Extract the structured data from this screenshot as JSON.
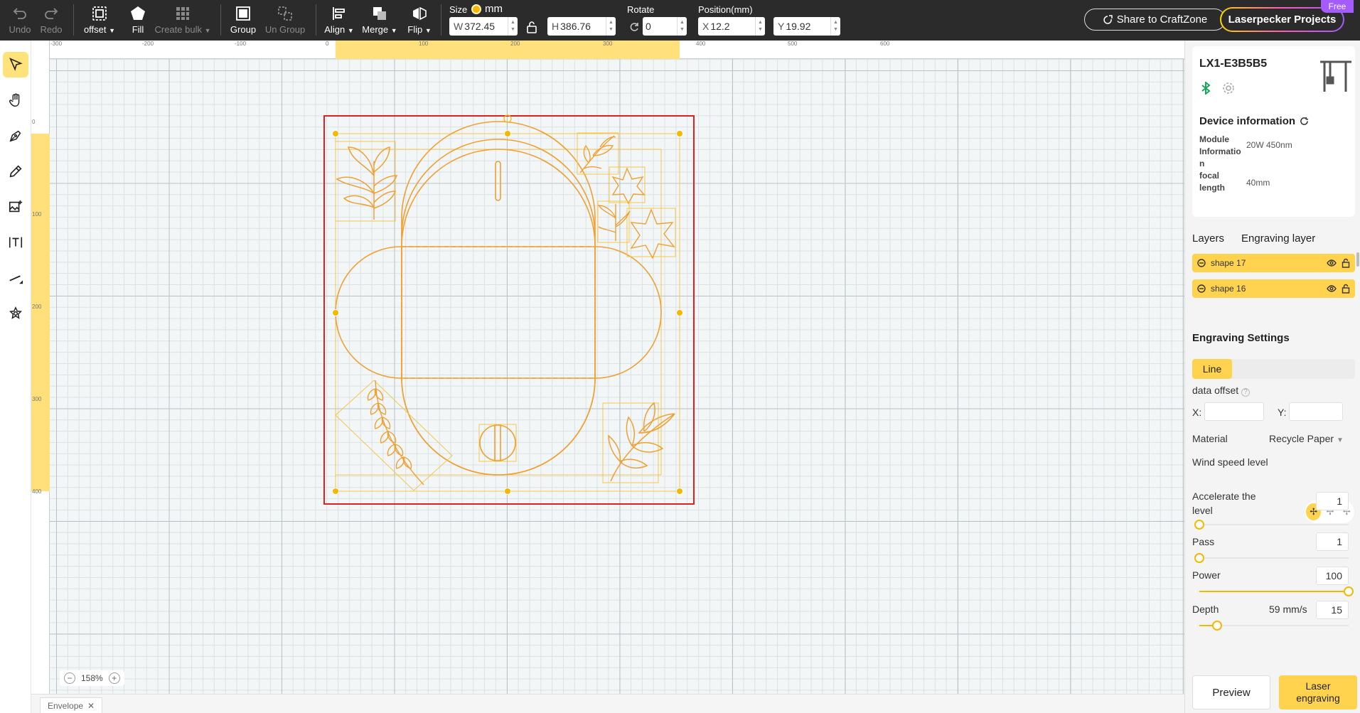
{
  "toolbar": {
    "undo": "Undo",
    "redo": "Redo",
    "offset": "offset",
    "fill": "Fill",
    "create_bulk": "Create bulk",
    "group": "Group",
    "ungroup": "Un Group",
    "align": "Align",
    "merge": "Merge",
    "flip": "Flip",
    "size_label": "Size",
    "unit": "mm",
    "width_prefix": "W",
    "width": "372.45",
    "height_prefix": "H",
    "height": "386.76",
    "rotate_label": "Rotate",
    "rotate": "0",
    "position_label": "Position(mm)",
    "x_prefix": "X",
    "x": "12.2",
    "y_prefix": "Y",
    "y": "19.92",
    "share": "Share to CraftZone",
    "projects": "Laserpecker Projects",
    "free_badge": "Free"
  },
  "rulers": {
    "h_ticks": [
      "-300",
      "-200",
      "-100",
      "0",
      "100",
      "200",
      "300",
      "400",
      "500",
      "600"
    ],
    "v_ticks": [
      "0",
      "100",
      "200",
      "300",
      "400"
    ]
  },
  "canvas": {
    "zoom": "158%",
    "doc_tab": "Envelope"
  },
  "device": {
    "name": "LX1-E3B5B5",
    "info_title": "Device information",
    "module_label": "Module Informatio n",
    "module_value": "20W 450nm",
    "focal_label": "focal length",
    "focal_value": "40mm"
  },
  "layers": {
    "tabs": [
      "Layers",
      "Engraving layer"
    ],
    "items": [
      {
        "name": "shape 17"
      },
      {
        "name": "shape 16"
      }
    ]
  },
  "engraving": {
    "title": "Engraving Settings",
    "mode": "Line",
    "data_offset": "data offset",
    "x_label": "X:",
    "y_label": "Y:",
    "material_label": "Material",
    "material": "Recycle Paper",
    "wind_label": "Wind speed level",
    "accelerate_label": "Accelerate the level",
    "accelerate": "1",
    "accelerate_level": 0,
    "pass_label": "Pass",
    "pass": "1",
    "pass_level": 0,
    "power_label": "Power",
    "power": "100",
    "power_level": 1.0,
    "depth_label": "Depth",
    "depth_speed": "59 mm/s",
    "depth": "15",
    "depth_level": 0.12,
    "preview": "Preview",
    "laser": "Laser engraving"
  },
  "colors": {
    "accent": "#ffd34d",
    "artwork": "#f0a030",
    "selection": "#e02020"
  }
}
